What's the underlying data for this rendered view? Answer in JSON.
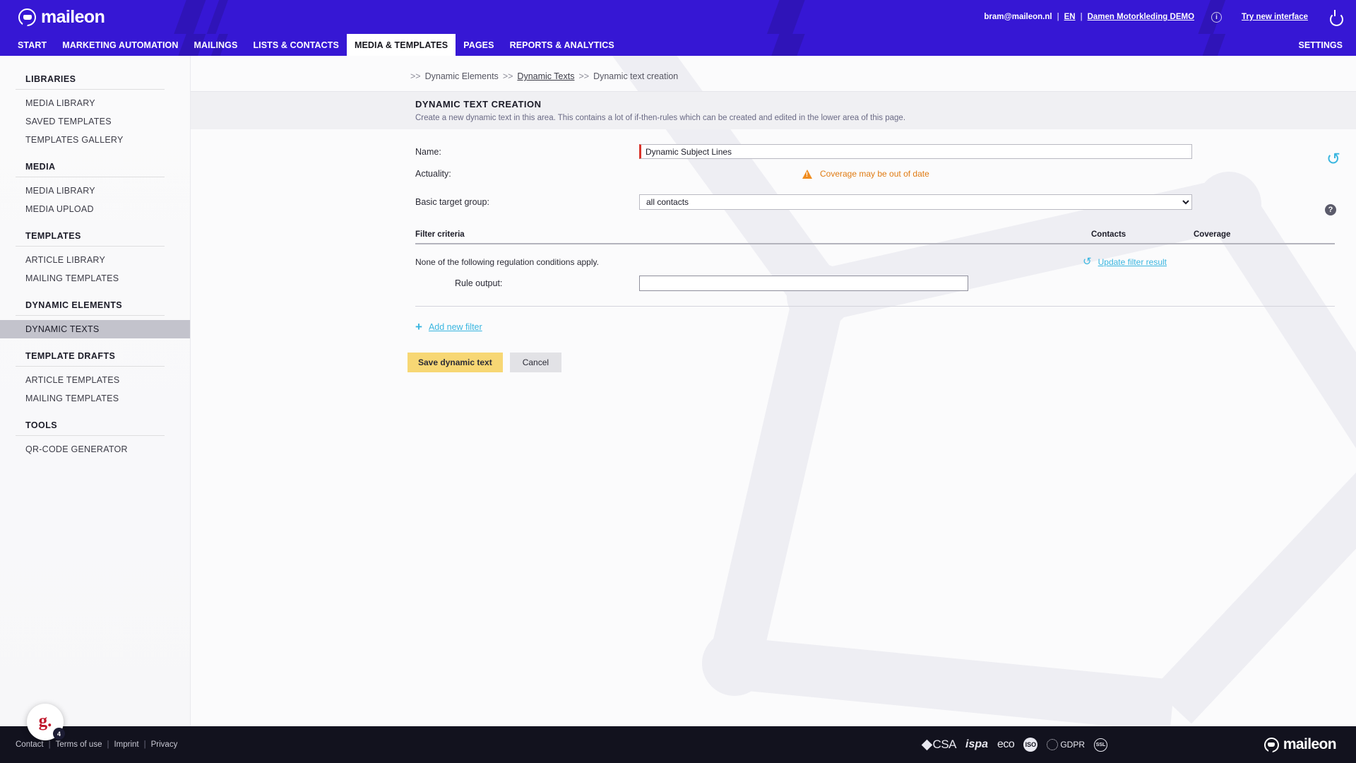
{
  "header": {
    "logo_text": "maileon",
    "user_email": "bram@maileon.nl",
    "language": "EN",
    "account": "Damen Motorkleding DEMO",
    "try_new": "Try new interface",
    "sep": "|",
    "info_icon": "info-icon",
    "power_icon": "power-icon"
  },
  "nav": {
    "items": [
      {
        "label": "START",
        "active": false
      },
      {
        "label": "MARKETING AUTOMATION",
        "active": false
      },
      {
        "label": "MAILINGS",
        "active": false
      },
      {
        "label": "LISTS & CONTACTS",
        "active": false
      },
      {
        "label": "MEDIA & TEMPLATES",
        "active": true
      },
      {
        "label": "PAGES",
        "active": false
      },
      {
        "label": "REPORTS & ANALYTICS",
        "active": false
      }
    ],
    "settings": "SETTINGS"
  },
  "sidebar": {
    "groups": [
      {
        "title": "LIBRARIES",
        "items": [
          {
            "label": "MEDIA LIBRARY",
            "active": false
          },
          {
            "label": "SAVED TEMPLATES",
            "active": false
          },
          {
            "label": "TEMPLATES GALLERY",
            "active": false
          }
        ]
      },
      {
        "title": "MEDIA",
        "items": [
          {
            "label": "MEDIA LIBRARY",
            "active": false
          },
          {
            "label": "MEDIA UPLOAD",
            "active": false
          }
        ]
      },
      {
        "title": "TEMPLATES",
        "items": [
          {
            "label": "ARTICLE LIBRARY",
            "active": false
          },
          {
            "label": "MAILING TEMPLATES",
            "active": false
          }
        ]
      },
      {
        "title": "DYNAMIC ELEMENTS",
        "items": [
          {
            "label": "DYNAMIC TEXTS",
            "active": true
          }
        ]
      },
      {
        "title": "TEMPLATE DRAFTS",
        "items": [
          {
            "label": "ARTICLE TEMPLATES",
            "active": false
          },
          {
            "label": "MAILING TEMPLATES",
            "active": false
          }
        ]
      },
      {
        "title": "TOOLS",
        "items": [
          {
            "label": "QR-CODE GENERATOR",
            "active": false
          }
        ]
      }
    ]
  },
  "breadcrumb": {
    "arrow": ">>",
    "item1": "Dynamic Elements",
    "item2": "Dynamic Texts",
    "item3": "Dynamic text creation"
  },
  "panel": {
    "title": "DYNAMIC TEXT CREATION",
    "description": "Create a new dynamic text in this area. This contains a lot of if-then-rules which can be created and edited in the lower area of this page."
  },
  "form": {
    "name_label": "Name:",
    "name_value": "Dynamic Subject Lines",
    "name_placeholder": "",
    "actuality_label": "Actuality:",
    "actuality_warning": "Coverage may be out of date",
    "target_group_label": "Basic target group:",
    "target_group_value": "all contacts",
    "target_group_options": [
      "all contacts"
    ],
    "refresh_icon": "refresh-icon",
    "help_icon": "help-icon",
    "warning_icon": "warning-triangle-icon"
  },
  "filter_table": {
    "col_filter": "Filter criteria",
    "col_contacts": "Contacts",
    "col_coverage": "Coverage",
    "no_conditions_text": "None of the following regulation conditions apply.",
    "update_link": "Update filter result",
    "update_icon": "refresh-icon",
    "rule_output_label": "Rule output:",
    "rule_output_value": "",
    "rule_output_placeholder": ""
  },
  "actions": {
    "add_filter": "Add new filter",
    "add_filter_icon": "plus-icon",
    "save_label": "Save dynamic text",
    "cancel_label": "Cancel"
  },
  "footer": {
    "links": [
      "Contact",
      "Terms of use",
      "Imprint",
      "Privacy"
    ],
    "sep": "|",
    "badges": [
      {
        "name": "csa-badge",
        "label": "CSA"
      },
      {
        "name": "ispa-badge",
        "label": "ispa"
      },
      {
        "name": "eco-badge",
        "label": "eco"
      },
      {
        "name": "iso-badge",
        "label": "ISO"
      },
      {
        "name": "gdpr-badge",
        "label": "GDPR"
      },
      {
        "name": "ssl-badge",
        "label": "SSL"
      }
    ],
    "logo_text": "maileon"
  },
  "widget": {
    "letter": "g.",
    "badge_count": "4"
  },
  "colors": {
    "brand_purple": "#3617d4",
    "accent_cyan": "#3ab6e0",
    "warning_orange": "#e07b12",
    "save_yellow": "#f7d774",
    "error_red": "#d9342b",
    "footer_dark": "#12121e"
  }
}
